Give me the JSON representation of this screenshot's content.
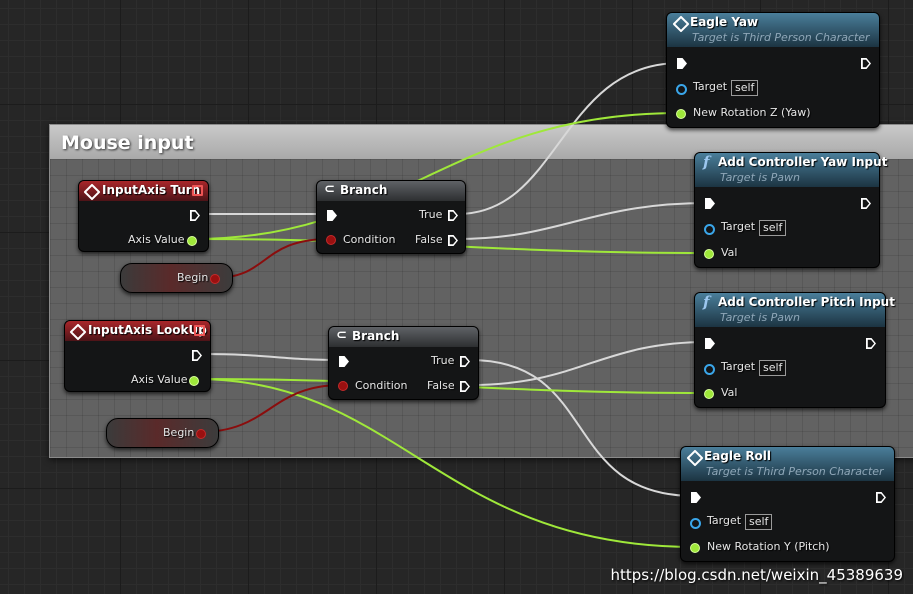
{
  "comment": {
    "title": "Mouse input",
    "color": "#a9a9a9"
  },
  "nodes": {
    "eagle_yaw": {
      "title": "Eagle Yaw",
      "subtitle": "Target is Third Person Character",
      "target_label": "Target",
      "target_value": "self",
      "param_label": "New Rotation Z (Yaw)"
    },
    "yaw_input": {
      "title": "Add Controller Yaw Input",
      "subtitle": "Target is Pawn",
      "target_label": "Target",
      "target_value": "self",
      "param_label": "Val"
    },
    "pitch_input": {
      "title": "Add Controller Pitch Input",
      "subtitle": "Target is Pawn",
      "target_label": "Target",
      "target_value": "self",
      "param_label": "Val"
    },
    "eagle_roll": {
      "title": "Eagle Roll",
      "subtitle": "Target is Third Person Character",
      "target_label": "Target",
      "target_value": "self",
      "param_label": "New Rotation Y (Pitch)"
    },
    "axis_turn": {
      "title": "InputAxis Turn",
      "output_label": "Axis Value"
    },
    "axis_lookup": {
      "title": "InputAxis LookUp",
      "output_label": "Axis Value"
    },
    "branch1": {
      "title": "Branch",
      "condition_label": "Condition",
      "true_label": "True",
      "false_label": "False"
    },
    "branch2": {
      "title": "Branch",
      "condition_label": "Condition",
      "true_label": "True",
      "false_label": "False"
    },
    "begin1": {
      "label": "Begin"
    },
    "begin2": {
      "label": "Begin"
    }
  },
  "icons": {
    "event": "diamond-icon",
    "function": "function-f-icon",
    "branch": "branch-icon"
  },
  "colors": {
    "exec_wire": "#d8d8d8",
    "float_wire": "#9fe83a",
    "bool_wire": "#8a0d0d",
    "event_header": "#a9262a",
    "function_header": "#4a7e9a"
  },
  "watermark": "https://blog.csdn.net/weixin_45389639"
}
